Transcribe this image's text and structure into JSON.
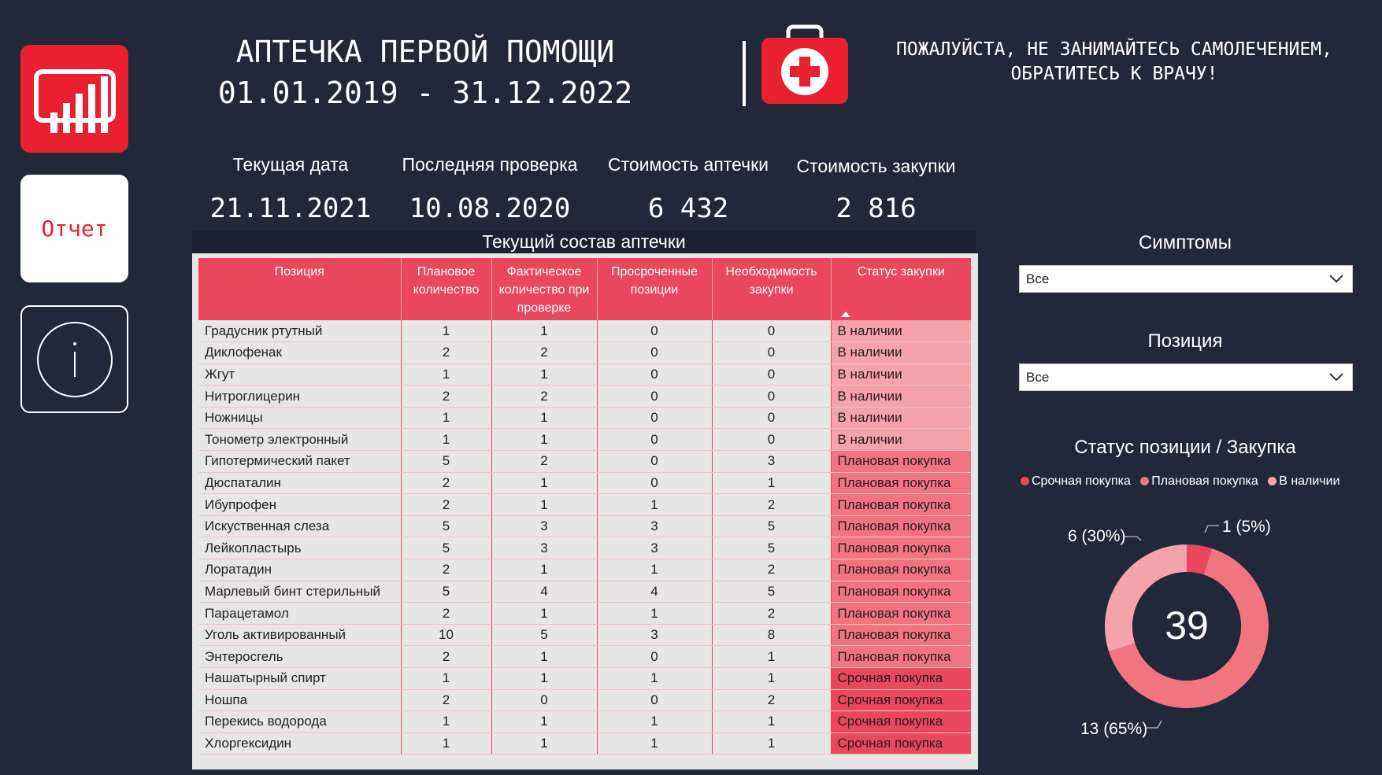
{
  "nav": {
    "report_label": "Отчет"
  },
  "header": {
    "title_line1": "АПТЕЧКА ПЕРВОЙ ПОМОЩИ",
    "title_line2": "01.01.2019 - 31.12.2022",
    "notice_line1": "ПОЖАЛУЙСТА, НЕ ЗАНИМАЙТЕСЬ САМОЛЕЧЕНИЕМ,",
    "notice_line2": "ОБРАТИТЕСЬ К ВРАЧУ!"
  },
  "kpis": [
    {
      "label": "Текущая дата",
      "value": "21.11.2021"
    },
    {
      "label": "Последняя проверка",
      "value": "10.08.2020"
    },
    {
      "label": "Стоимость аптечки",
      "value": "6 432"
    },
    {
      "label": "Стоимость закупки",
      "value": "2 816"
    }
  ],
  "table": {
    "caption": "Текущий состав аптечки",
    "columns": [
      "Позиция",
      "Плановое количество",
      "Фактическое количество при проверке",
      "Просроченные позиции",
      "Необходимость закупки",
      "Статус закупки"
    ],
    "rows": [
      [
        "Градусник ртутный",
        "1",
        "1",
        "0",
        "0",
        "В наличии"
      ],
      [
        "Диклофенак",
        "2",
        "2",
        "0",
        "0",
        "В наличии"
      ],
      [
        "Жгут",
        "1",
        "1",
        "0",
        "0",
        "В наличии"
      ],
      [
        "Нитроглицерин",
        "2",
        "2",
        "0",
        "0",
        "В наличии"
      ],
      [
        "Ножницы",
        "1",
        "1",
        "0",
        "0",
        "В наличии"
      ],
      [
        "Тонометр электронный",
        "1",
        "1",
        "0",
        "0",
        "В наличии"
      ],
      [
        "Гипотермический пакет",
        "5",
        "2",
        "0",
        "3",
        "Плановая покупка"
      ],
      [
        "Дюспаталин",
        "2",
        "1",
        "0",
        "1",
        "Плановая покупка"
      ],
      [
        "Ибупрофен",
        "2",
        "1",
        "1",
        "2",
        "Плановая покупка"
      ],
      [
        "Искуственная слеза",
        "5",
        "3",
        "3",
        "5",
        "Плановая покупка"
      ],
      [
        "Лейкопластырь",
        "5",
        "3",
        "3",
        "5",
        "Плановая покупка"
      ],
      [
        "Лоратадин",
        "2",
        "1",
        "1",
        "2",
        "Плановая покупка"
      ],
      [
        "Марлевый бинт стерильный",
        "5",
        "4",
        "4",
        "5",
        "Плановая покупка"
      ],
      [
        "Парацетамол",
        "2",
        "1",
        "1",
        "2",
        "Плановая покупка"
      ],
      [
        "Уголь активированный",
        "10",
        "5",
        "3",
        "8",
        "Плановая покупка"
      ],
      [
        "Энтеросгель",
        "2",
        "1",
        "0",
        "1",
        "Плановая покупка"
      ],
      [
        "Нашатырный спирт",
        "1",
        "1",
        "1",
        "1",
        "Срочная покупка"
      ],
      [
        "Ношпа",
        "2",
        "0",
        "0",
        "2",
        "Срочная покупка"
      ],
      [
        "Перекись водорода",
        "1",
        "1",
        "1",
        "1",
        "Срочная покупка"
      ],
      [
        "Хлоргексидин",
        "1",
        "1",
        "1",
        "1",
        "Срочная покупка"
      ]
    ],
    "status_colors": {
      "В наличии": "#f4a3ad",
      "Плановая покупка": "#f07581",
      "Срочная покупка": "#e8475c"
    }
  },
  "filters": {
    "symptoms": {
      "label": "Симптомы",
      "value": "Все"
    },
    "position": {
      "label": "Позиция",
      "value": "Все"
    }
  },
  "chart_data": {
    "type": "pie",
    "title": "Статус позиции / Закупка",
    "categories": [
      "Срочная покупка",
      "Плановая покупка",
      "В наличии"
    ],
    "values": [
      1,
      13,
      6
    ],
    "data_labels": [
      "1 (5%)",
      "13 (65%)",
      "6 (30%)"
    ],
    "colors": [
      "#e8475c",
      "#f07581",
      "#f4a3ad"
    ],
    "center_value": "39",
    "legend_position": "top"
  }
}
